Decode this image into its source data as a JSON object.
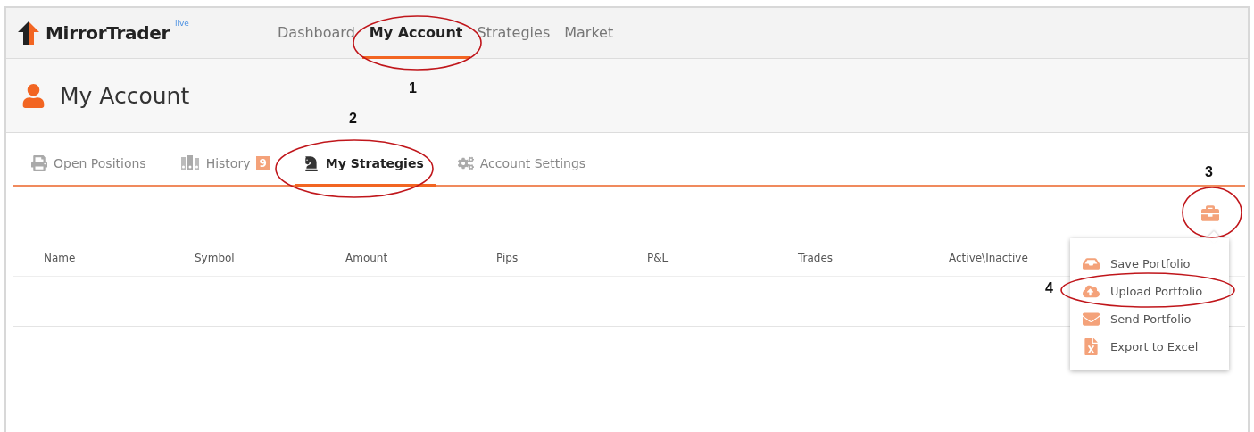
{
  "app": {
    "logo": "MirrorTrader",
    "badge": "live"
  },
  "nav": [
    {
      "label": "Dashboard",
      "selected": false
    },
    {
      "label": "My Account",
      "selected": true
    },
    {
      "label": "Strategies",
      "selected": false
    },
    {
      "label": "Market",
      "selected": false
    }
  ],
  "page_title": "My Account",
  "tabs": [
    {
      "label": "Open Positions",
      "selected": false
    },
    {
      "label": "History",
      "count": "9",
      "selected": false
    },
    {
      "label": "My Strategies",
      "selected": true
    },
    {
      "label": "Account Settings",
      "selected": false
    }
  ],
  "table": {
    "columns": [
      "Name",
      "Symbol",
      "Amount",
      "Pips",
      "P&L",
      "Trades",
      "Active\\Inactive"
    ]
  },
  "portfolio_menu": {
    "expanded": true,
    "items": [
      {
        "label": "Save Portfolio"
      },
      {
        "label": "Upload Portfolio"
      },
      {
        "label": "Send Portfolio"
      },
      {
        "label": "Export to Excel"
      }
    ]
  },
  "annotations": [
    "1",
    "2",
    "3",
    "4"
  ]
}
